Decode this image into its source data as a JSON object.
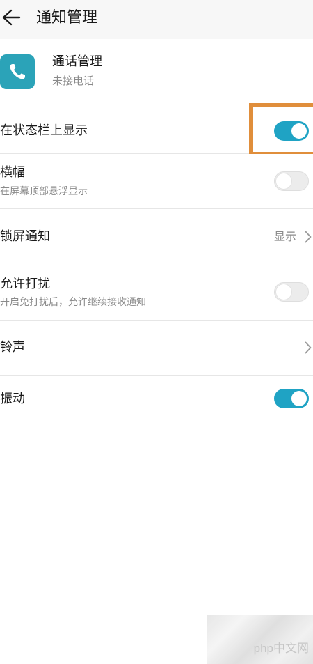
{
  "header": {
    "title": "通知管理",
    "back_icon": "arrow-left-icon"
  },
  "app": {
    "name": "通话管理",
    "subtitle": "未接电话",
    "icon": "phone-icon",
    "icon_color": "#2ba3b8"
  },
  "settings": {
    "status_bar": {
      "title": "在状态栏上显示",
      "enabled": true
    },
    "banner": {
      "title": "横幅",
      "subtitle": "在屏幕顶部悬浮显示",
      "enabled": false
    },
    "lock_screen": {
      "title": "锁屏通知",
      "value": "显示"
    },
    "dnd": {
      "title": "允许打扰",
      "subtitle": "开启免打扰后，允许继续接收通知",
      "enabled": false
    },
    "ringtone": {
      "title": "铃声"
    },
    "vibrate": {
      "title": "振动",
      "enabled": true
    }
  },
  "colors": {
    "accent": "#1fa3c4",
    "highlight": "#e08e3b"
  },
  "watermark": {
    "text": "php中文网"
  }
}
